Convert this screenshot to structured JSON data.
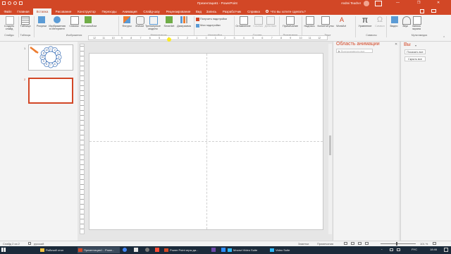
{
  "titlebar": {
    "title": "Презентация1 - PowerPoint",
    "user": "Andrei Teacher",
    "minimize": "—",
    "restore": "❐",
    "close": "✕"
  },
  "tabs": [
    {
      "label": "Файл"
    },
    {
      "label": "Главная"
    },
    {
      "label": "Вставка"
    },
    {
      "label": "Рисование"
    },
    {
      "label": "Конструктор"
    },
    {
      "label": "Переходы"
    },
    {
      "label": "Анимация"
    },
    {
      "label": "Слайд-шоу"
    },
    {
      "label": "Рецензирование"
    },
    {
      "label": "Вид"
    },
    {
      "label": "Запись"
    },
    {
      "label": "Разработчик"
    },
    {
      "label": "Справка"
    },
    {
      "label": "Что вы хотите сделать?"
    }
  ],
  "ribbon": {
    "slides": {
      "btn1": "Создать",
      "btn1b": "слайд",
      "group": "Слайды"
    },
    "tables": {
      "btn": "Таблица",
      "group": "Таблицы"
    },
    "images": {
      "b1": "Рисунки",
      "b2": "Изображения",
      "b2b": "в Интернете",
      "b3": "Снимок",
      "b4": "Фотоальбом",
      "group": "Изображения"
    },
    "illus": {
      "b1": "Фигуры",
      "b2": "Значки",
      "b3": "Трехмерные",
      "b3b": "модели",
      "b4": "SmartArt",
      "b5": "Диаграмма",
      "group": "Иллюстрации"
    },
    "addins": {
      "b1": "Получить надстройки",
      "b2": "Мои надстройки",
      "group": "Надстройки"
    },
    "links": {
      "b1": "Ссылка",
      "b2": "Действие",
      "b0": "Оглавление",
      "group": "Ссылки"
    },
    "comments": {
      "b1": "Примечание",
      "group": "Примечания"
    },
    "text": {
      "b1": "Надпись",
      "b2": "Колонтитулы",
      "b3": "WordArt",
      "group": "Текст"
    },
    "symbols": {
      "b1": "Уравнение",
      "b2": "Символ",
      "group": "Символы"
    },
    "media": {
      "b1": "Видео",
      "b2": "Звук",
      "b3": "Запись",
      "b3b": "экрана",
      "group": "Мультимедиа"
    }
  },
  "ruler_labels": [
    "12",
    "11",
    "10",
    "9",
    "8",
    "7",
    "6",
    "5",
    "4",
    "3",
    "2",
    "1",
    "0",
    "1",
    "2",
    "3",
    "4",
    "5",
    "6",
    "7",
    "8",
    "9",
    "10",
    "11",
    "12"
  ],
  "thumbs": [
    {
      "number": "1"
    },
    {
      "number": "2"
    }
  ],
  "diagram_digits": [
    "1",
    "2",
    "3",
    "4",
    "5",
    "6",
    "7",
    "8",
    "9",
    "10",
    "11",
    "12"
  ],
  "anim_pane": {
    "title": "Область анимации",
    "play": "▶ Воспроизвести все",
    "close": "✕"
  },
  "selection_pane": {
    "title": "Вы",
    "show_all": "Показать все",
    "hide_all": "Скрыть все"
  },
  "status": {
    "slide": "Слайд 2 из 2",
    "lang": "русский",
    "notes": "Заметки",
    "comments": "Примечания",
    "zoom": "101 %"
  },
  "taskbar": {
    "items": [
      {
        "label": "Рабочий стол"
      },
      {
        "label": "Презентация1 - Powe..."
      },
      {
        "label": "Power Point игры да..."
      },
      {
        "label": "Movavi Video Suite"
      },
      {
        "label": "Video Suite"
      }
    ],
    "lang": "РУС",
    "time": "18:46"
  }
}
